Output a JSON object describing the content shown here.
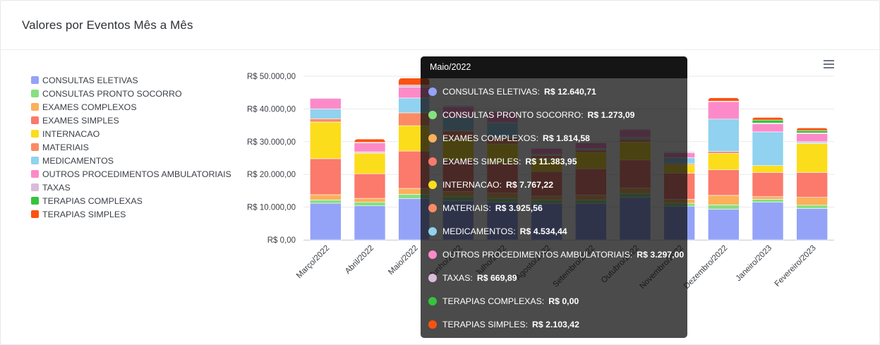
{
  "card": {
    "title": "Valores por Eventos Mês a Mês"
  },
  "menu": {
    "icon": "hamburger-menu-icon"
  },
  "chart_data": {
    "type": "bar",
    "stacked": true,
    "title": "",
    "xlabel": "",
    "ylabel": "",
    "ylim": [
      0,
      50000
    ],
    "yticks": [
      0,
      10000,
      20000,
      30000,
      40000,
      50000
    ],
    "ytick_labels": [
      "R$ 0,00",
      "R$ 10.000,00",
      "R$ 20.000,00",
      "R$ 30.000,00",
      "R$ 40.000,00",
      "R$ 50.000,00"
    ],
    "grid": true,
    "legend_position": "left",
    "categories": [
      "Março/2022",
      "Abril/2022",
      "Maio/2022",
      "Junho/2022",
      "Julho/2022",
      "Agosto/2022",
      "Setembro/2022",
      "Outubro/2022",
      "Novembro/2022",
      "Dezembro/2022",
      "Janeiro/2023",
      "Fevereiro/2023"
    ],
    "series": [
      {
        "name": "CONSULTAS ELETIVAS",
        "color": "#94a3f8",
        "values": [
          11200,
          10400,
          12640.71,
          12000,
          11500,
          11200,
          11200,
          13000,
          10300,
          9400,
          11500,
          9600
        ]
      },
      {
        "name": "CONSULTAS PRONTO SOCORRO",
        "color": "#86e07f",
        "values": [
          1000,
          1100,
          1273.09,
          1200,
          1200,
          1000,
          1000,
          1200,
          900,
          1300,
          900,
          1000
        ]
      },
      {
        "name": "EXAMES COMPLEXOS",
        "color": "#fcb05a",
        "values": [
          1600,
          1200,
          1814.58,
          1600,
          1600,
          1200,
          1500,
          1700,
          1200,
          2900,
          800,
          2400
        ]
      },
      {
        "name": "EXAMES SIMPLES",
        "color": "#fb7a6b",
        "values": [
          11000,
          7500,
          11383.95,
          9500,
          9000,
          7500,
          8000,
          8500,
          8000,
          7800,
          7400,
          7600
        ]
      },
      {
        "name": "INTERNACAO",
        "color": "#fcdd1c",
        "values": [
          11200,
          6200,
          7767.22,
          6500,
          6000,
          4000,
          5000,
          5500,
          2500,
          5000,
          2100,
          8800
        ]
      },
      {
        "name": "MATERIAIS",
        "color": "#fb8b65",
        "values": [
          1000,
          300,
          3925.56,
          2500,
          2000,
          900,
          800,
          900,
          400,
          600,
          0,
          200
        ]
      },
      {
        "name": "MEDICAMENTOS",
        "color": "#90d2ef",
        "values": [
          3000,
          200,
          4534.44,
          4000,
          4500,
          300,
          400,
          500,
          1800,
          9900,
          10300,
          400
        ]
      },
      {
        "name": "OUTROS PROCEDIMENTOS AMBULATORIAIS",
        "color": "#fd8ac8",
        "values": [
          3200,
          2700,
          3297.0,
          3300,
          3200,
          1800,
          1700,
          2300,
          1500,
          5300,
          2400,
          2400
        ]
      },
      {
        "name": "TAXAS",
        "color": "#d9bcd9",
        "values": [
          200,
          200,
          669.89,
          400,
          400,
          200,
          200,
          300,
          300,
          200,
          300,
          300
        ]
      },
      {
        "name": "TERAPIAS COMPLEXAS",
        "color": "#35c43c",
        "values": [
          0,
          0,
          0.0,
          0,
          0,
          0,
          0,
          0,
          0,
          0,
          900,
          700
        ]
      },
      {
        "name": "TERAPIAS SIMPLES",
        "color": "#fb5212",
        "values": [
          0,
          1000,
          2103.42,
          0,
          0,
          0,
          0,
          0,
          0,
          1000,
          800,
          800
        ]
      }
    ],
    "hover_index": 3
  },
  "tooltip": {
    "title": "Maio/2022",
    "rows": [
      {
        "label": "CONSULTAS ELETIVAS:",
        "value": "R$ 12.640,71",
        "color": "#94a3f8"
      },
      {
        "label": "CONSULTAS PRONTO SOCORRO:",
        "value": "R$ 1.273,09",
        "color": "#86e07f"
      },
      {
        "label": "EXAMES COMPLEXOS:",
        "value": "R$ 1.814,58",
        "color": "#fcb05a"
      },
      {
        "label": "EXAMES SIMPLES:",
        "value": "R$ 11.383,95",
        "color": "#fb7a6b"
      },
      {
        "label": "INTERNACAO:",
        "value": "R$ 7.767,22",
        "color": "#fcdd1c"
      },
      {
        "label": "MATERIAIS:",
        "value": "R$ 3.925,56",
        "color": "#fb8b65"
      },
      {
        "label": "MEDICAMENTOS:",
        "value": "R$ 4.534,44",
        "color": "#90d2ef"
      },
      {
        "label": "OUTROS PROCEDIMENTOS AMBULATORIAIS:",
        "value": "R$ 3.297,00",
        "color": "#fd8ac8"
      },
      {
        "label": "TAXAS:",
        "value": "R$ 669,89",
        "color": "#d9bcd9"
      },
      {
        "label": "TERAPIAS COMPLEXAS:",
        "value": "R$ 0,00",
        "color": "#35c43c"
      },
      {
        "label": "TERAPIAS SIMPLES:",
        "value": "R$ 2.103,42",
        "color": "#fb5212"
      }
    ]
  }
}
